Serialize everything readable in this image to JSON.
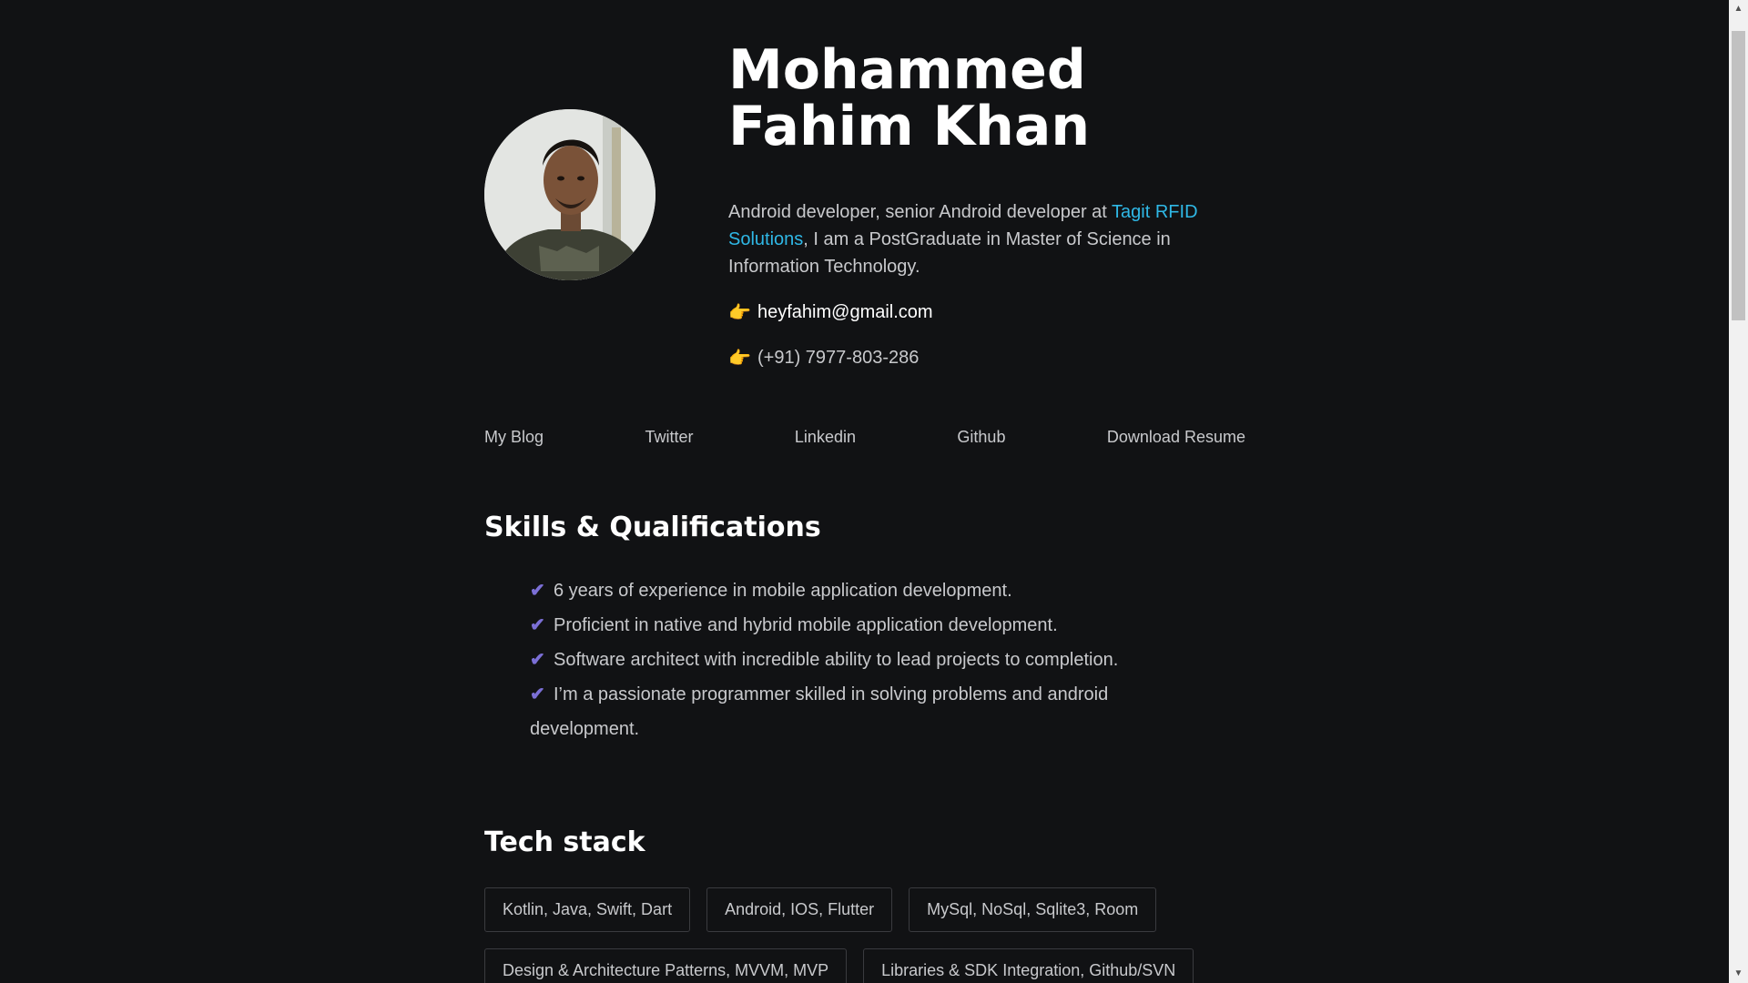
{
  "profile": {
    "name": "Mohammed Fahim Khan",
    "bio_prefix": "Android developer, senior Android developer at ",
    "company": "Tagit RFID Solutions",
    "bio_suffix": ", I am a PostGraduate in Master of Science in Information Technology.",
    "email": "heyfahim@gmail.com",
    "phone": "(+91) 7977-803-286",
    "pointer_icon": "👉"
  },
  "nav": {
    "items": [
      "My Blog",
      "Twitter",
      "Linkedin",
      "Github",
      "Download Resume"
    ]
  },
  "skills": {
    "title": "Skills & Qualifications",
    "check_icon": "✔",
    "items": [
      "6 years of experience in mobile application development.",
      "Proficient in native and hybrid mobile application development.",
      "Software architect with incredible ability to lead projects to completion.",
      "I’m a passionate programmer skilled in solving problems and android development."
    ]
  },
  "tech": {
    "title": "Tech stack",
    "rows": [
      [
        "Kotlin, Java, Swift, Dart",
        "Android, IOS, Flutter",
        "MySql, NoSql, Sqlite3, Room"
      ],
      [
        "Design & Architecture Patterns, MVVM, MVP",
        "Libraries & SDK Integration, Github/SVN"
      ]
    ]
  },
  "colors": {
    "background": "#111214",
    "accent_link": "#2fb8e6",
    "check": "#7b6fd6",
    "text": "#c8c9cc"
  }
}
